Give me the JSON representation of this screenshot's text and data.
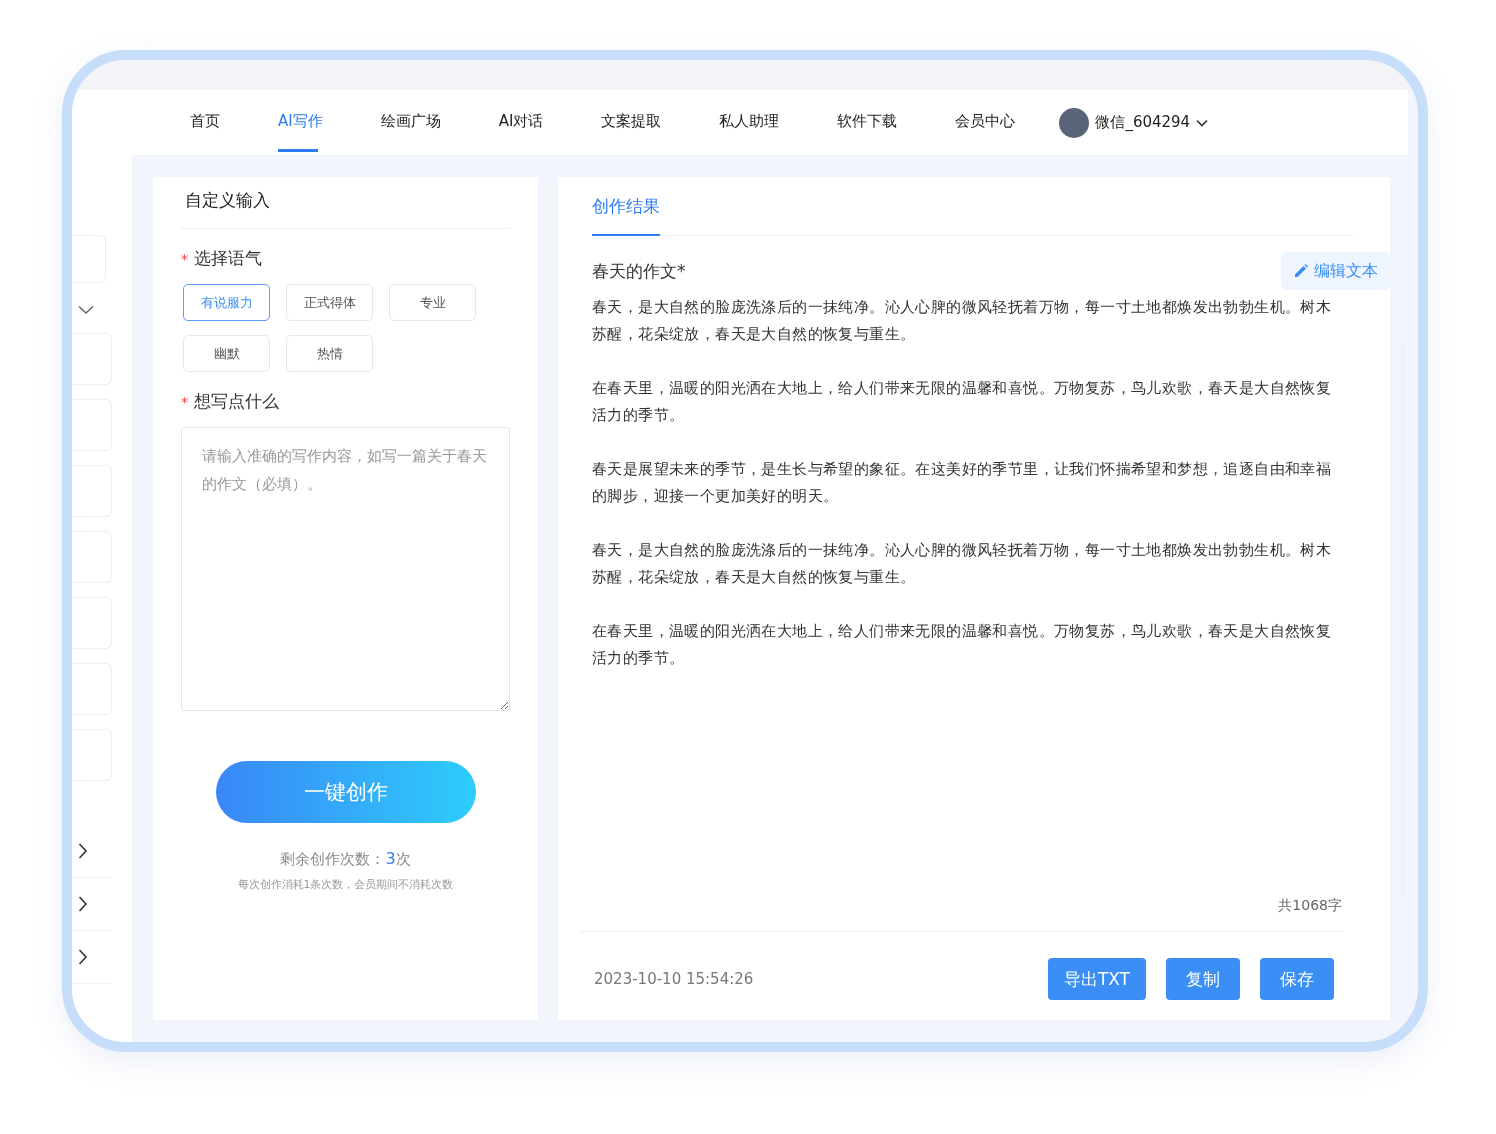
{
  "nav": {
    "items": [
      {
        "label": "首页",
        "selected": false
      },
      {
        "label": "AI写作",
        "selected": true
      },
      {
        "label": "绘画广场",
        "selected": false
      },
      {
        "label": "AI对话",
        "selected": false
      },
      {
        "label": "文案提取",
        "selected": false
      },
      {
        "label": "私人助理",
        "selected": false
      },
      {
        "label": "软件下载",
        "selected": false
      },
      {
        "label": "会员中心",
        "selected": false
      }
    ],
    "user": {
      "name": "微信_604294"
    }
  },
  "input_panel": {
    "title": "自定义输入",
    "tone": {
      "label": "选择语气",
      "required_mark": "*",
      "options": [
        {
          "label": "有说服力",
          "selected": true
        },
        {
          "label": "正式得体",
          "selected": false
        },
        {
          "label": "专业",
          "selected": false
        },
        {
          "label": "幽默",
          "selected": false
        },
        {
          "label": "热情",
          "selected": false
        }
      ]
    },
    "content": {
      "label": "想写点什么",
      "required_mark": "*",
      "placeholder": "请输入准确的写作内容，如写一篇关于春天的作文（必填）。"
    },
    "create_button": "一键创作",
    "remaining": {
      "label": "剩余创作次数：",
      "count": "3",
      "unit": "次"
    },
    "note": "每次创作消耗1条次数，会员期间不消耗次数"
  },
  "result_panel": {
    "tab": "创作结果",
    "doc_title": "春天的作文*",
    "edit_button": "编辑文本",
    "paragraphs": [
      "春天，是大自然的脸庞洗涤后的一抹纯净。沁人心脾的微风轻抚着万物，每一寸土地都焕发出勃勃生机。树木苏醒，花朵绽放，春天是大自然的恢复与重生。",
      "在春天里，温暖的阳光洒在大地上，给人们带来无限的温馨和喜悦。万物复苏，鸟儿欢歌，春天是大自然恢复活力的季节。",
      "春天是展望未来的季节，是生长与希望的象征。在这美好的季节里，让我们怀揣希望和梦想，追逐自由和幸福的脚步，迎接一个更加美好的明天。",
      "春天，是大自然的脸庞洗涤后的一抹纯净。沁人心脾的微风轻抚着万物，每一寸土地都焕发出勃勃生机。树木苏醒，花朵绽放，春天是大自然的恢复与重生。",
      "在春天里，温暖的阳光洒在大地上，给人们带来无限的温馨和喜悦。万物复苏，鸟儿欢歌，春天是大自然恢复活力的季节。"
    ],
    "word_count": "共1068字",
    "timestamp": "2023-10-10 15:54:26",
    "buttons": [
      "导出TXT",
      "复制",
      "保存"
    ]
  }
}
